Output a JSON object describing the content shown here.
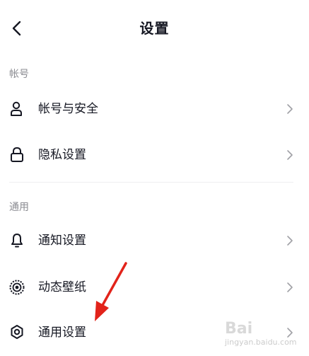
{
  "header": {
    "title": "设置"
  },
  "sections": [
    {
      "label": "帐号"
    },
    {
      "label": "通用"
    }
  ],
  "rows": [
    {
      "label": "帐号与安全"
    },
    {
      "label": "隐私设置"
    },
    {
      "label": "通知设置"
    },
    {
      "label": "动态壁纸"
    },
    {
      "label": "通用设置"
    }
  ],
  "watermark": {
    "brand": "Bai",
    "url": "jingyan.baidu.com"
  },
  "icons": {
    "back": "chevron-left-icon",
    "account": "person-icon",
    "privacy": "lock-icon",
    "notify": "bell-icon",
    "wallpaper": "radar-circle-icon",
    "general": "gear-icon"
  },
  "colors": {
    "annotation_arrow": "#e2231a"
  }
}
